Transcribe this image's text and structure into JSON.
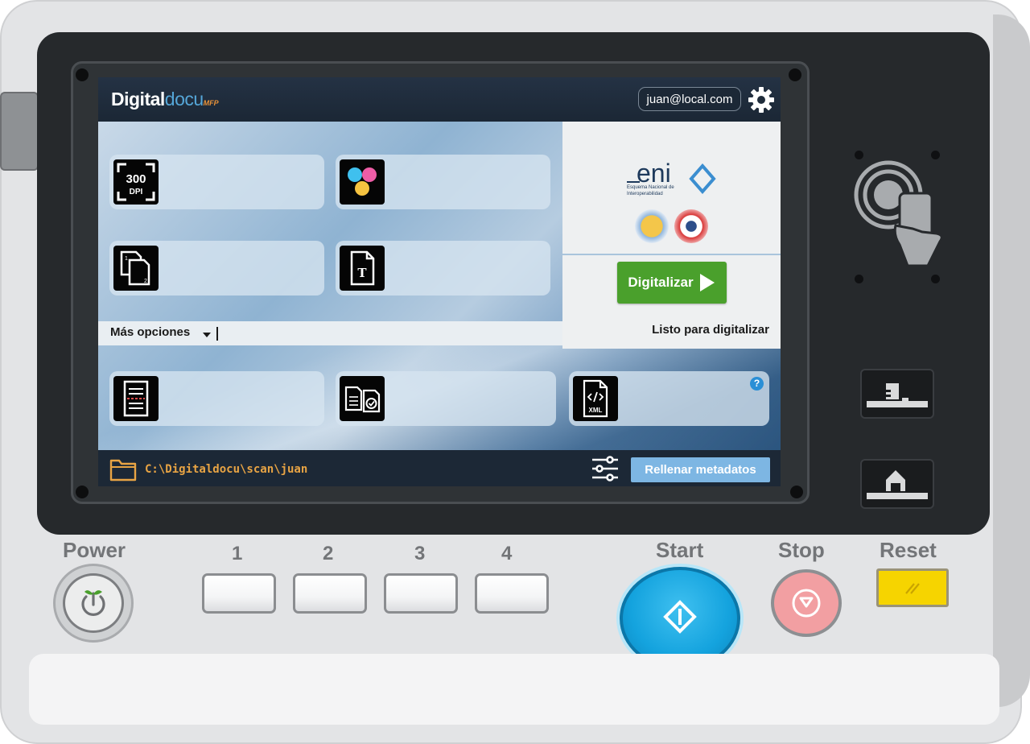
{
  "app": {
    "logo_main": "Digital",
    "logo_docu": "docu",
    "logo_mfp": "MFP",
    "user": "juan@local.com"
  },
  "tiles": {
    "resolution_text_top": "300",
    "resolution_text_bottom": "DPI",
    "doc_text_glyph": "T",
    "xml_text": "XML",
    "help_glyph": "?"
  },
  "right_panel": {
    "eni_text": "eni",
    "eni_sub1": "Esquema Nacional de",
    "eni_sub2": "Interoperabilidad",
    "digitize_label": "Digitalizar",
    "status": "Listo para digitalizar"
  },
  "options": {
    "more_label": "Más opciones"
  },
  "bottombar": {
    "path": "C:\\Digitaldocu\\scan\\juan",
    "metadata_button": "Rellenar metadatos"
  },
  "panel": {
    "power_label": "Power",
    "memory_keys": [
      "1",
      "2",
      "3",
      "4"
    ],
    "start_label": "Start",
    "stop_label": "Stop",
    "reset_label": "Reset"
  },
  "colors": {
    "accent_green": "#4aa02c",
    "accent_blue": "#7db6e3",
    "path_orange": "#e8a444",
    "start_blue": "#14a3de",
    "stop_pink": "#f29fa2",
    "reset_yellow": "#f6d400"
  }
}
